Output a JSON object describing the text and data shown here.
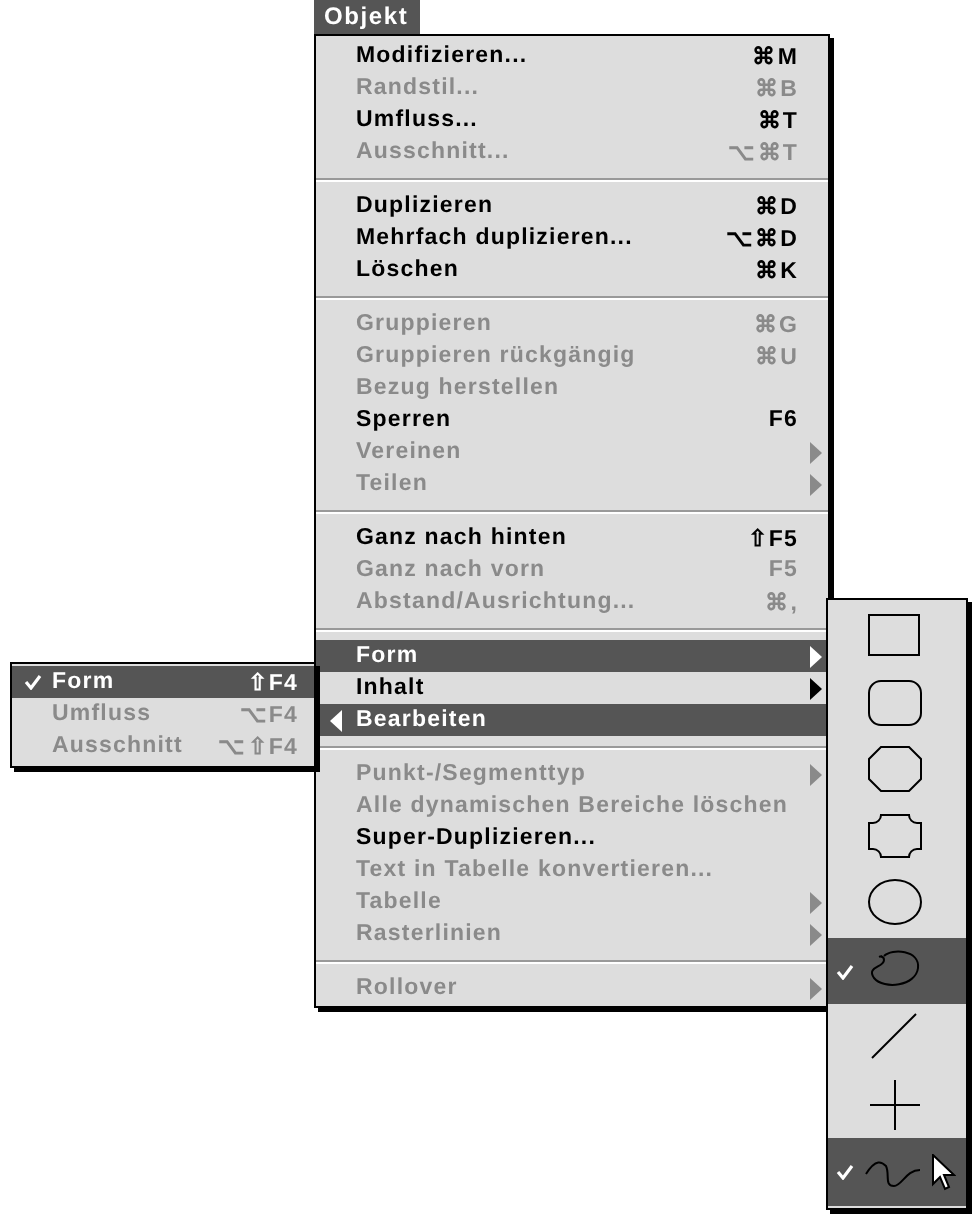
{
  "menu_title": "Objekt",
  "menu": {
    "items": [
      {
        "kind": "item",
        "label": "Modifizieren...",
        "shortcut": "⌘M",
        "disabled": false,
        "selected": false,
        "submenu": false
      },
      {
        "kind": "item",
        "label": "Randstil...",
        "shortcut": "⌘B",
        "disabled": true,
        "selected": false,
        "submenu": false
      },
      {
        "kind": "item",
        "label": "Umfluss...",
        "shortcut": "⌘T",
        "disabled": false,
        "selected": false,
        "submenu": false
      },
      {
        "kind": "item",
        "label": "Ausschnitt...",
        "shortcut": "⌥⌘T",
        "disabled": true,
        "selected": false,
        "submenu": false
      },
      {
        "kind": "separator"
      },
      {
        "kind": "item",
        "label": "Duplizieren",
        "shortcut": "⌘D",
        "disabled": false,
        "selected": false,
        "submenu": false
      },
      {
        "kind": "item",
        "label": "Mehrfach duplizieren...",
        "shortcut": "⌥⌘D",
        "disabled": false,
        "selected": false,
        "submenu": false
      },
      {
        "kind": "item",
        "label": "Löschen",
        "shortcut": "⌘K",
        "disabled": false,
        "selected": false,
        "submenu": false
      },
      {
        "kind": "separator"
      },
      {
        "kind": "item",
        "label": "Gruppieren",
        "shortcut": "⌘G",
        "disabled": true,
        "selected": false,
        "submenu": false
      },
      {
        "kind": "item",
        "label": "Gruppieren rückgängig",
        "shortcut": "⌘U",
        "disabled": true,
        "selected": false,
        "submenu": false
      },
      {
        "kind": "item",
        "label": "Bezug herstellen",
        "disabled": true,
        "selected": false,
        "submenu": false
      },
      {
        "kind": "item",
        "label": "Sperren",
        "shortcut": "F6",
        "disabled": false,
        "selected": false,
        "submenu": false
      },
      {
        "kind": "item",
        "label": "Vereinen",
        "disabled": true,
        "selected": false,
        "submenu": true,
        "opens_left": false
      },
      {
        "kind": "item",
        "label": "Teilen",
        "disabled": true,
        "selected": false,
        "submenu": true,
        "opens_left": false
      },
      {
        "kind": "separator"
      },
      {
        "kind": "item",
        "label": "Ganz nach hinten",
        "shortcut": "⇧F5",
        "disabled": false,
        "selected": false,
        "submenu": false
      },
      {
        "kind": "item",
        "label": "Ganz nach vorn",
        "shortcut": "F5",
        "disabled": true,
        "selected": false,
        "submenu": false
      },
      {
        "kind": "item",
        "label": "Abstand/Ausrichtung...",
        "shortcut": "⌘,",
        "disabled": true,
        "selected": false,
        "submenu": false
      },
      {
        "kind": "separator"
      },
      {
        "kind": "item",
        "label": "Form",
        "disabled": false,
        "selected": true,
        "submenu": true,
        "opens_left": false
      },
      {
        "kind": "item",
        "label": "Inhalt",
        "disabled": false,
        "selected": false,
        "submenu": true,
        "opens_left": false
      },
      {
        "kind": "item",
        "label": "Bearbeiten",
        "disabled": false,
        "selected": true,
        "submenu": true,
        "opens_left": true
      },
      {
        "kind": "separator"
      },
      {
        "kind": "item",
        "label": "Punkt-/Segmenttyp",
        "disabled": true,
        "selected": false,
        "submenu": true,
        "opens_left": false
      },
      {
        "kind": "item",
        "label": "Alle dynamischen Bereiche löschen",
        "disabled": true,
        "selected": false,
        "submenu": false
      },
      {
        "kind": "item",
        "label": "Super-Duplizieren...",
        "disabled": false,
        "selected": false,
        "submenu": false
      },
      {
        "kind": "item",
        "label": "Text in Tabelle konvertieren...",
        "disabled": true,
        "selected": false,
        "submenu": false
      },
      {
        "kind": "item",
        "label": "Tabelle",
        "disabled": true,
        "selected": false,
        "submenu": true,
        "opens_left": false
      },
      {
        "kind": "item",
        "label": "Rasterlinien",
        "disabled": true,
        "selected": false,
        "submenu": true,
        "opens_left": false
      },
      {
        "kind": "separator"
      },
      {
        "kind": "item",
        "label": "Rollover",
        "disabled": true,
        "selected": false,
        "submenu": true,
        "opens_left": false
      }
    ]
  },
  "edit_submenu": {
    "items": [
      {
        "label": "Form",
        "shortcut": "⇧F4",
        "checked": true,
        "disabled": false,
        "selected": true
      },
      {
        "label": "Umfluss",
        "shortcut": "⌥F4",
        "checked": false,
        "disabled": true,
        "selected": false
      },
      {
        "label": "Ausschnitt",
        "shortcut": "⌥⇧F4",
        "checked": false,
        "disabled": true,
        "selected": false
      }
    ]
  },
  "shape_palette": {
    "items": [
      {
        "kind": "rectangle",
        "checked": false,
        "selected": false
      },
      {
        "kind": "rounded-rectangle",
        "checked": false,
        "selected": false
      },
      {
        "kind": "beveled-rectangle",
        "checked": false,
        "selected": false
      },
      {
        "kind": "concave-rectangle",
        "checked": false,
        "selected": false
      },
      {
        "kind": "oval",
        "checked": false,
        "selected": false
      },
      {
        "kind": "freeform",
        "checked": true,
        "selected": true
      },
      {
        "kind": "line",
        "checked": false,
        "selected": false
      },
      {
        "kind": "crosshair",
        "checked": false,
        "selected": false
      },
      {
        "kind": "bezier",
        "checked": true,
        "selected": true
      }
    ]
  }
}
